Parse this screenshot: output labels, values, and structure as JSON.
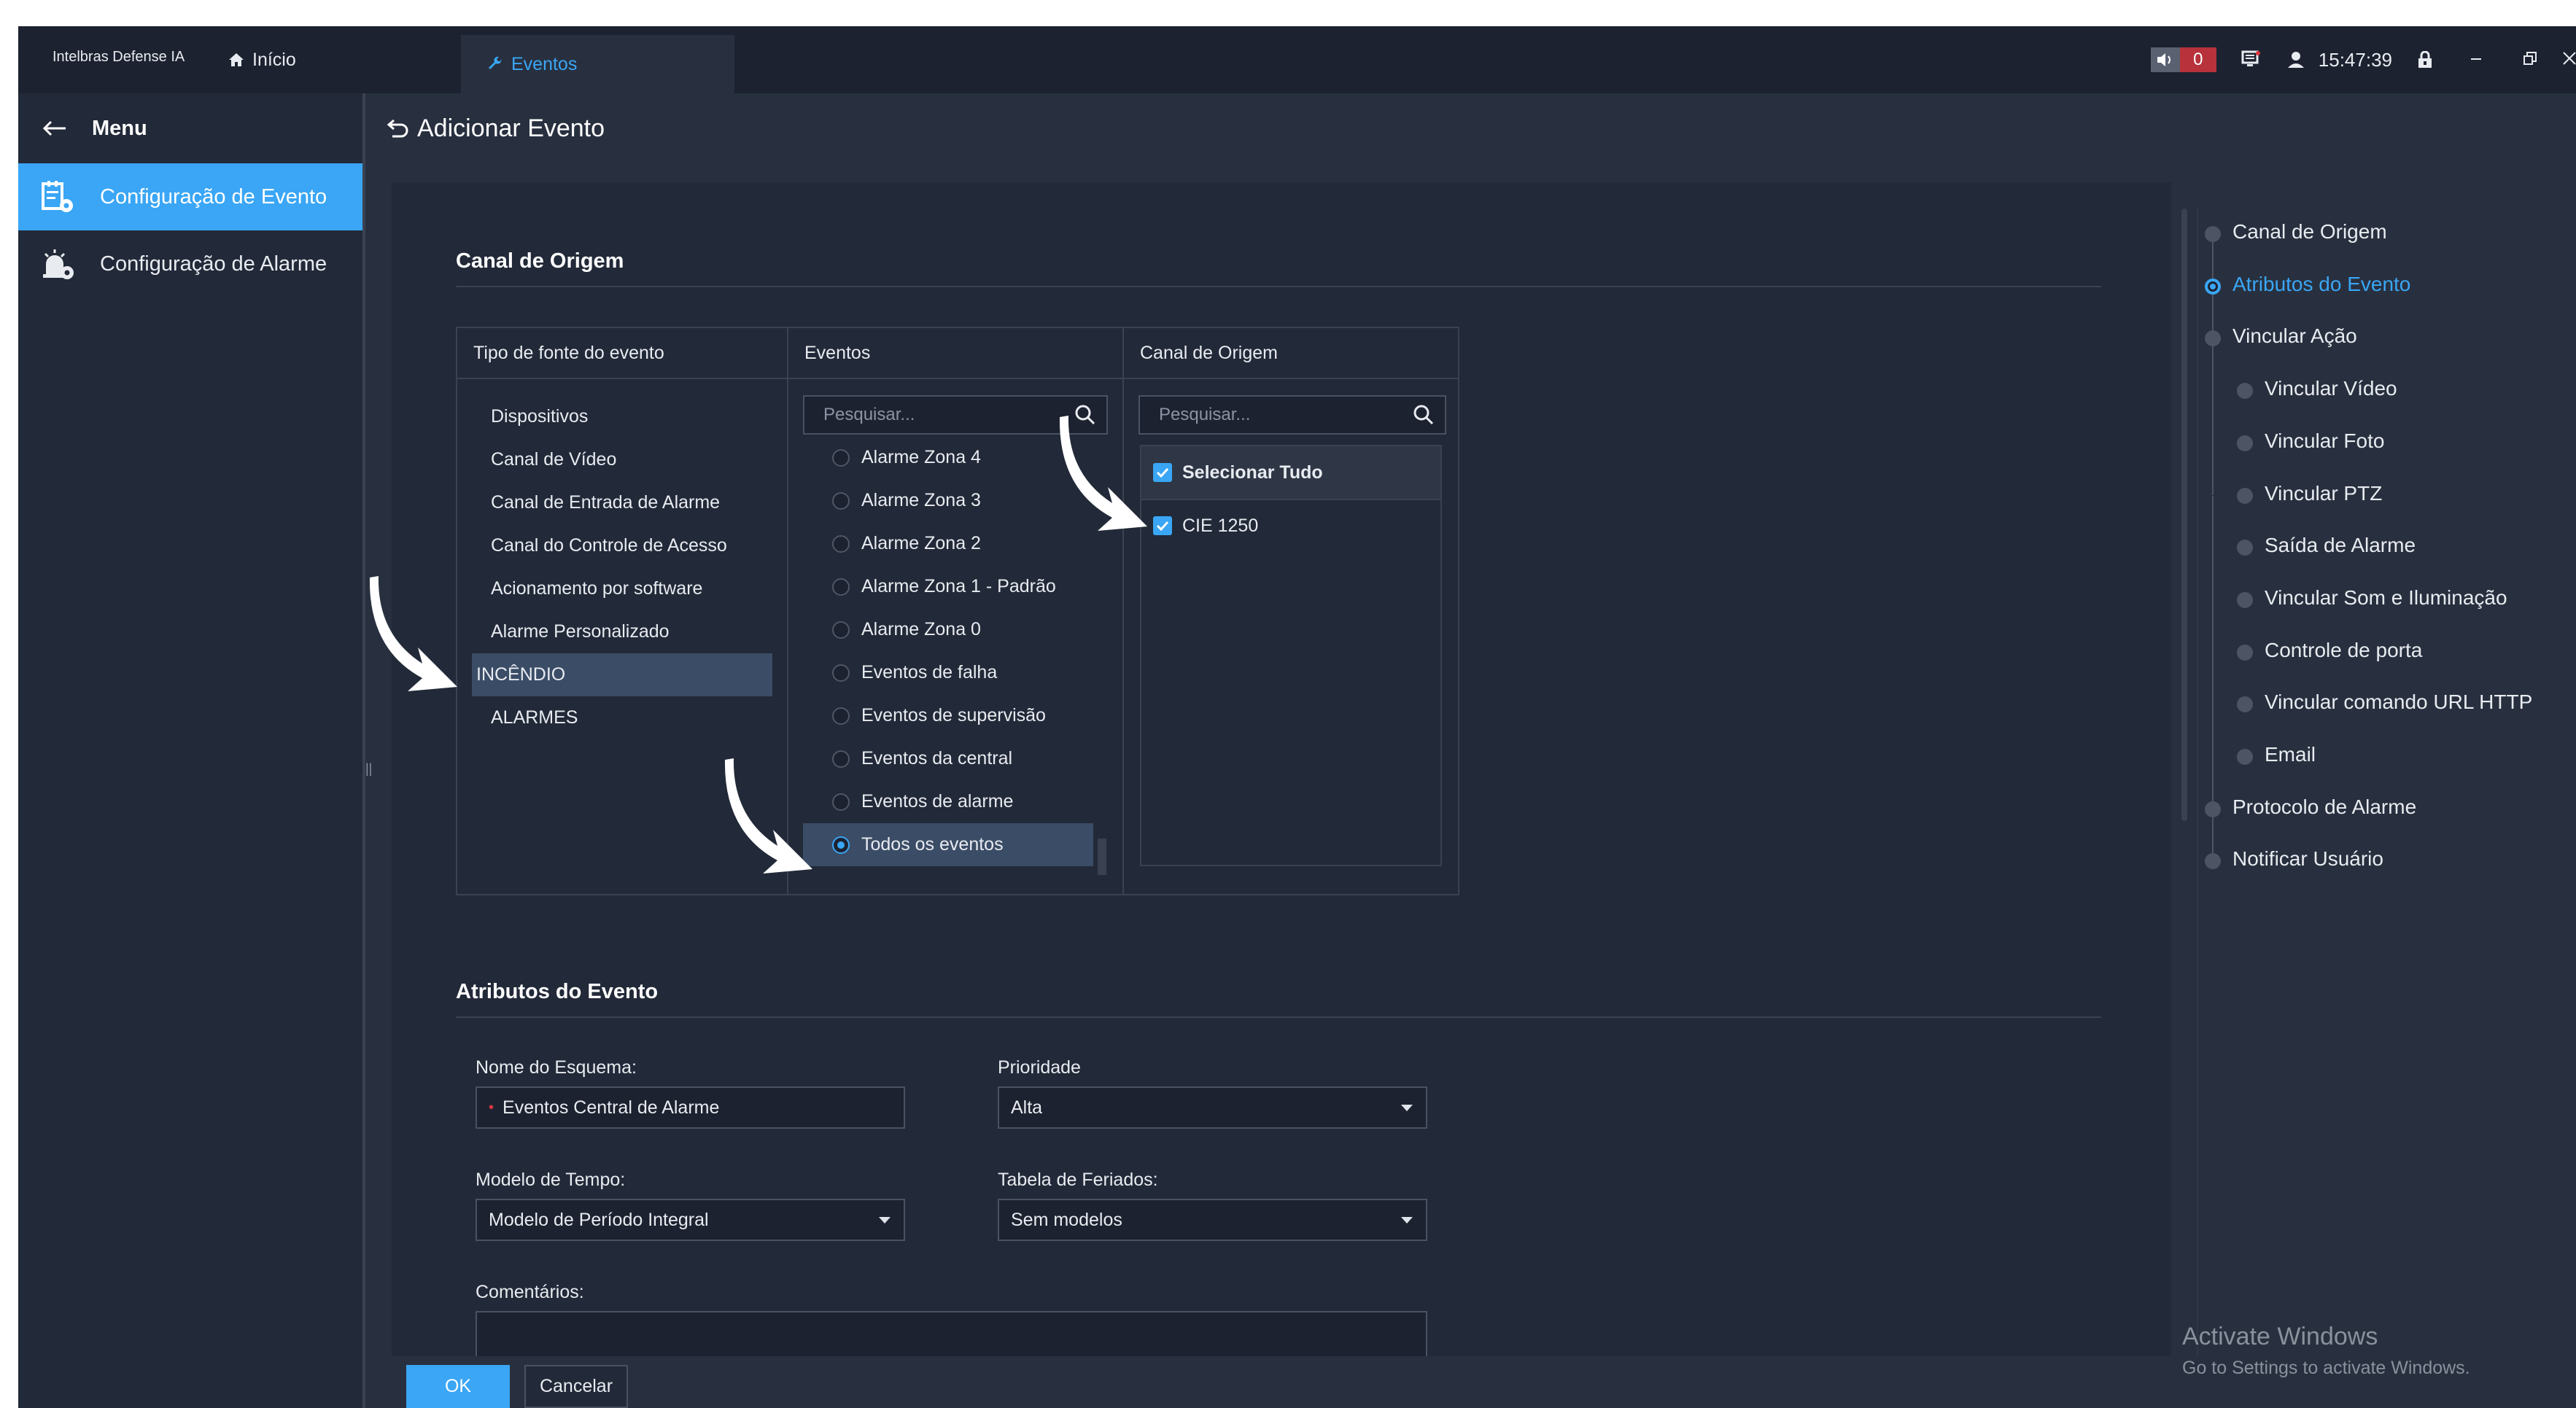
{
  "app": {
    "brand": "Intelbras Defense IA",
    "tabs": [
      {
        "label": "Início"
      },
      {
        "label": "Eventos"
      }
    ],
    "status": {
      "alarm_count": "0",
      "clock": "15:47:39"
    }
  },
  "menu": {
    "title": "Menu",
    "items": [
      {
        "label": "Configuração de Evento"
      },
      {
        "label": "Configuração de Alarme"
      }
    ]
  },
  "page": {
    "title": "Adicionar Evento"
  },
  "origin": {
    "section_title": "Canal de Origem",
    "col_source_header": "Tipo de fonte do evento",
    "col_events_header": "Eventos",
    "col_channel_header": "Canal de Origem",
    "source_types": [
      "Dispositivos",
      "Canal de Vídeo",
      "Canal de Entrada de Alarme",
      "Canal do Controle de Acesso",
      "Acionamento por software",
      "Alarme Personalizado",
      "INCÊNDIO",
      "ALARMES"
    ],
    "selected_source": "INCÊNDIO",
    "events_search_placeholder": "Pesquisar...",
    "events": [
      "Alarme Zona 4",
      "Alarme Zona 3",
      "Alarme Zona 2",
      "Alarme Zona 1 - Padrão",
      "Alarme Zona 0",
      "Eventos de falha",
      "Eventos de supervisão",
      "Eventos da central",
      "Eventos de alarme",
      "Todos os eventos"
    ],
    "selected_event": "Todos os eventos",
    "channel_search_placeholder": "Pesquisar...",
    "select_all_label": "Selecionar Tudo",
    "channels": [
      "CIE 1250"
    ]
  },
  "attributes": {
    "section_title": "Atributos do Evento",
    "schema_name_label": "Nome do Esquema:",
    "schema_name_value": "Eventos Central de Alarme",
    "priority_label": "Prioridade",
    "priority_value": "Alta",
    "time_model_label": "Modelo de Tempo:",
    "time_model_value": "Modelo de Período Integral",
    "holiday_label": "Tabela de Feriados:",
    "holiday_value": "Sem modelos",
    "comments_label": "Comentários:"
  },
  "steps": [
    {
      "label": "Canal de Origem",
      "level": 0
    },
    {
      "label": "Atributos do Evento",
      "level": 0,
      "active": true
    },
    {
      "label": "Vincular Ação",
      "level": 0
    },
    {
      "label": "Vincular Vídeo",
      "level": 1
    },
    {
      "label": "Vincular Foto",
      "level": 1
    },
    {
      "label": "Vincular PTZ",
      "level": 1
    },
    {
      "label": "Saída de Alarme",
      "level": 1
    },
    {
      "label": "Vincular Som e Iluminação",
      "level": 1
    },
    {
      "label": "Controle de porta",
      "level": 1
    },
    {
      "label": "Vincular comando URL HTTP",
      "level": 1
    },
    {
      "label": "Email",
      "level": 1
    },
    {
      "label": "Protocolo de Alarme",
      "level": 0
    },
    {
      "label": "Notificar Usuário",
      "level": 0
    }
  ],
  "footer": {
    "ok_label": "OK",
    "cancel_label": "Cancelar"
  },
  "watermark": {
    "line1": "Activate Windows",
    "line2": "Go to Settings to activate Windows."
  },
  "colors": {
    "accent": "#3aa6f5",
    "alarm_badge": "#b7323a"
  },
  "icons": [
    "home-icon",
    "wrench-icon",
    "volume-icon",
    "monitor-icon",
    "user-icon",
    "lock-icon",
    "minimize-icon",
    "restore-icon",
    "close-icon",
    "back-arrow-icon",
    "event-config-icon",
    "alarm-config-icon",
    "undo-icon",
    "search-icon",
    "checkmark-icon"
  ]
}
